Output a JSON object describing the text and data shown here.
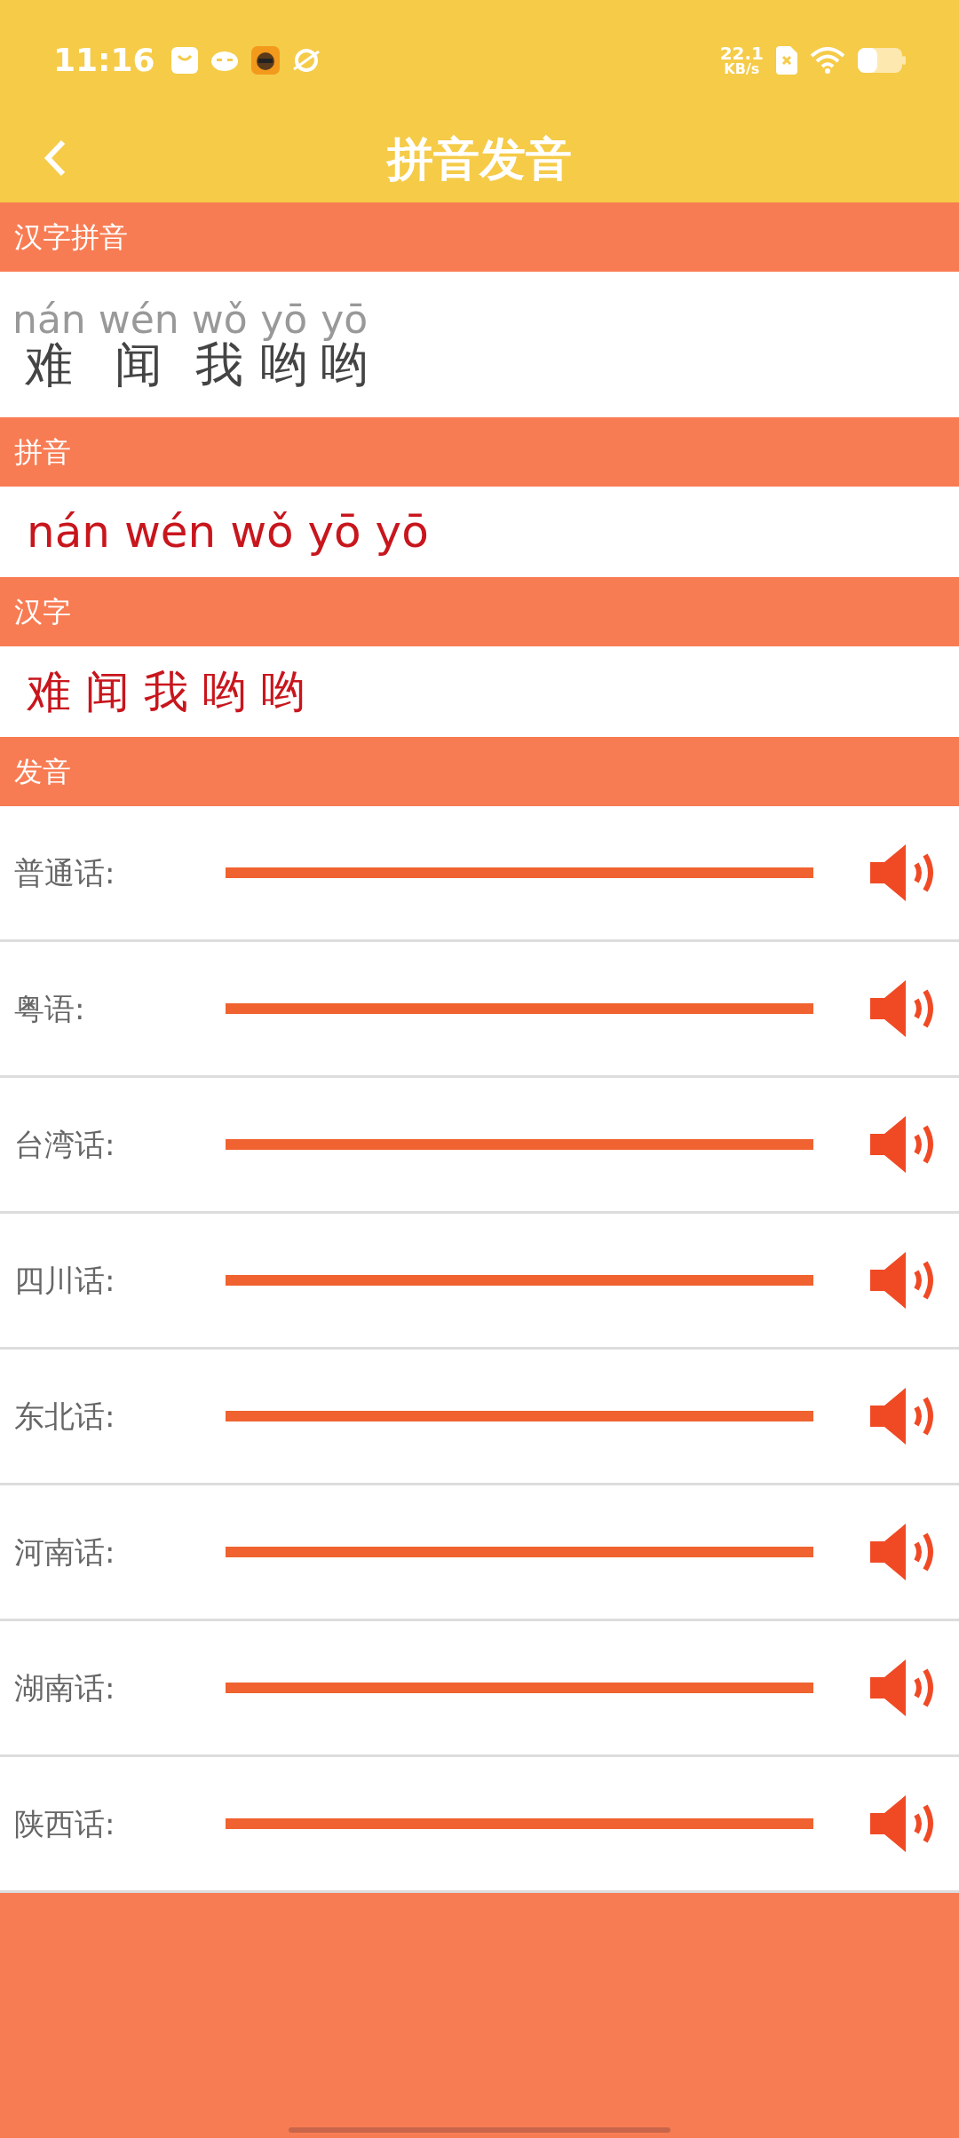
{
  "status_bar": {
    "time": "11:16",
    "speed_value": "22.1",
    "speed_unit": "KB/s"
  },
  "header": {
    "title": "拼音发音"
  },
  "sections": [
    {
      "title": "汉字拼音",
      "kind": "annotated",
      "pairs": [
        {
          "pinyin": "nán",
          "hanzi": "难"
        },
        {
          "pinyin": "wén",
          "hanzi": "闻"
        },
        {
          "pinyin": "wǒ",
          "hanzi": "我"
        },
        {
          "pinyin": "yō",
          "hanzi": "哟"
        },
        {
          "pinyin": "yō",
          "hanzi": "哟"
        }
      ]
    },
    {
      "title": "拼音",
      "kind": "text",
      "text": "nán wén wǒ yō yō"
    },
    {
      "title": "汉字",
      "kind": "text",
      "text": "难 闻 我 哟 哟"
    },
    {
      "title": "发音",
      "kind": "audio",
      "rows": [
        {
          "label": "普通话:",
          "level": 1
        },
        {
          "label": "粤语:",
          "level": 1
        },
        {
          "label": "台湾话:",
          "level": 1
        },
        {
          "label": "四川话:",
          "level": 1
        },
        {
          "label": "东北话:",
          "level": 1
        },
        {
          "label": "河南话:",
          "level": 1
        },
        {
          "label": "湖南话:",
          "level": 1
        },
        {
          "label": "陕西话:",
          "level": 1
        }
      ]
    }
  ]
}
